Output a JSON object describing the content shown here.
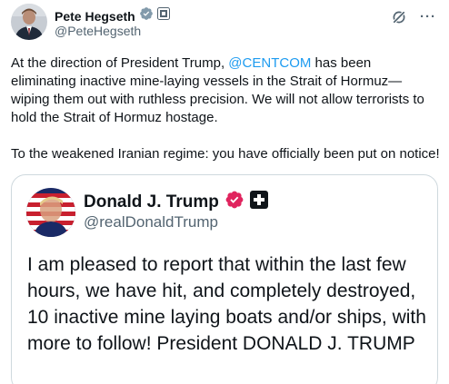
{
  "author": {
    "name": "Pete Hegseth",
    "handle": "@PeteHegseth"
  },
  "post": {
    "text_before_mention": "At the direction of President Trump, ",
    "mention": "@CENTCOM",
    "text_after_mention": " has been eliminating inactive mine-laying vessels in the Strait of Hormuz—wiping them out with ruthless precision. We will not allow terrorists to hold the Strait of Hormuz hostage.",
    "paragraph2": "To the weakened Iranian regime: you have officially been put on notice!"
  },
  "actions": {
    "more": "···"
  },
  "quoted": {
    "name": "Donald J. Trump",
    "handle": "@realDonaldTrump",
    "text": "I am pleased to report that within the last few hours, we have hit, and completely destroyed, 10 inactive mine laying boats and/or ships, with more to follow! President DONALD J. TRUMP"
  },
  "colors": {
    "link": "#1d9bf0",
    "verified_gray": "#829aab",
    "verified_gold": "#e0245e",
    "muted_text": "#536471"
  },
  "icons": [
    "verified-gray-icon",
    "government-badge-icon",
    "grok-icon",
    "more-icon",
    "verified-badge-icon",
    "affiliate-badge-icon"
  ]
}
